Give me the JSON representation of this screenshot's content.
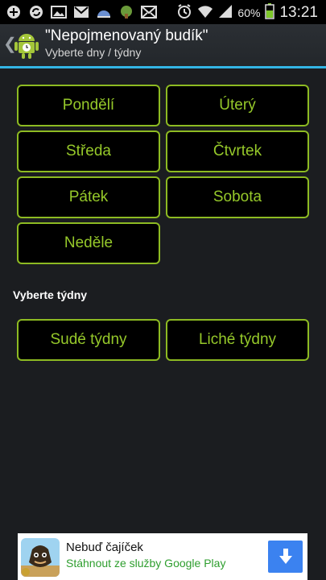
{
  "status_bar": {
    "icons": [
      "add-icon",
      "sync-icon",
      "image-icon",
      "gmail-icon",
      "weather-icon",
      "game-icon",
      "email-icon"
    ],
    "battery": "60%",
    "time": "13:21"
  },
  "action_bar": {
    "title": "\"Nepojmenovaný budík\"",
    "subtitle": "Vyberte dny / týdny"
  },
  "days": {
    "monday": "Pondělí",
    "tuesday": "Úterý",
    "wednesday": "Středa",
    "thursday": "Čtvrtek",
    "friday": "Pátek",
    "saturday": "Sobota",
    "sunday": "Neděle"
  },
  "weeks": {
    "section_label": "Vyberte týdny",
    "even": "Sudé týdny",
    "odd": "Liché týdny"
  },
  "ad": {
    "title": "Nebuď čajíček",
    "subtitle": "Stáhnout ze služby Google Play"
  },
  "colors": {
    "accent": "#96c92a",
    "divider": "#33b5e5",
    "background": "#1b1d20"
  }
}
